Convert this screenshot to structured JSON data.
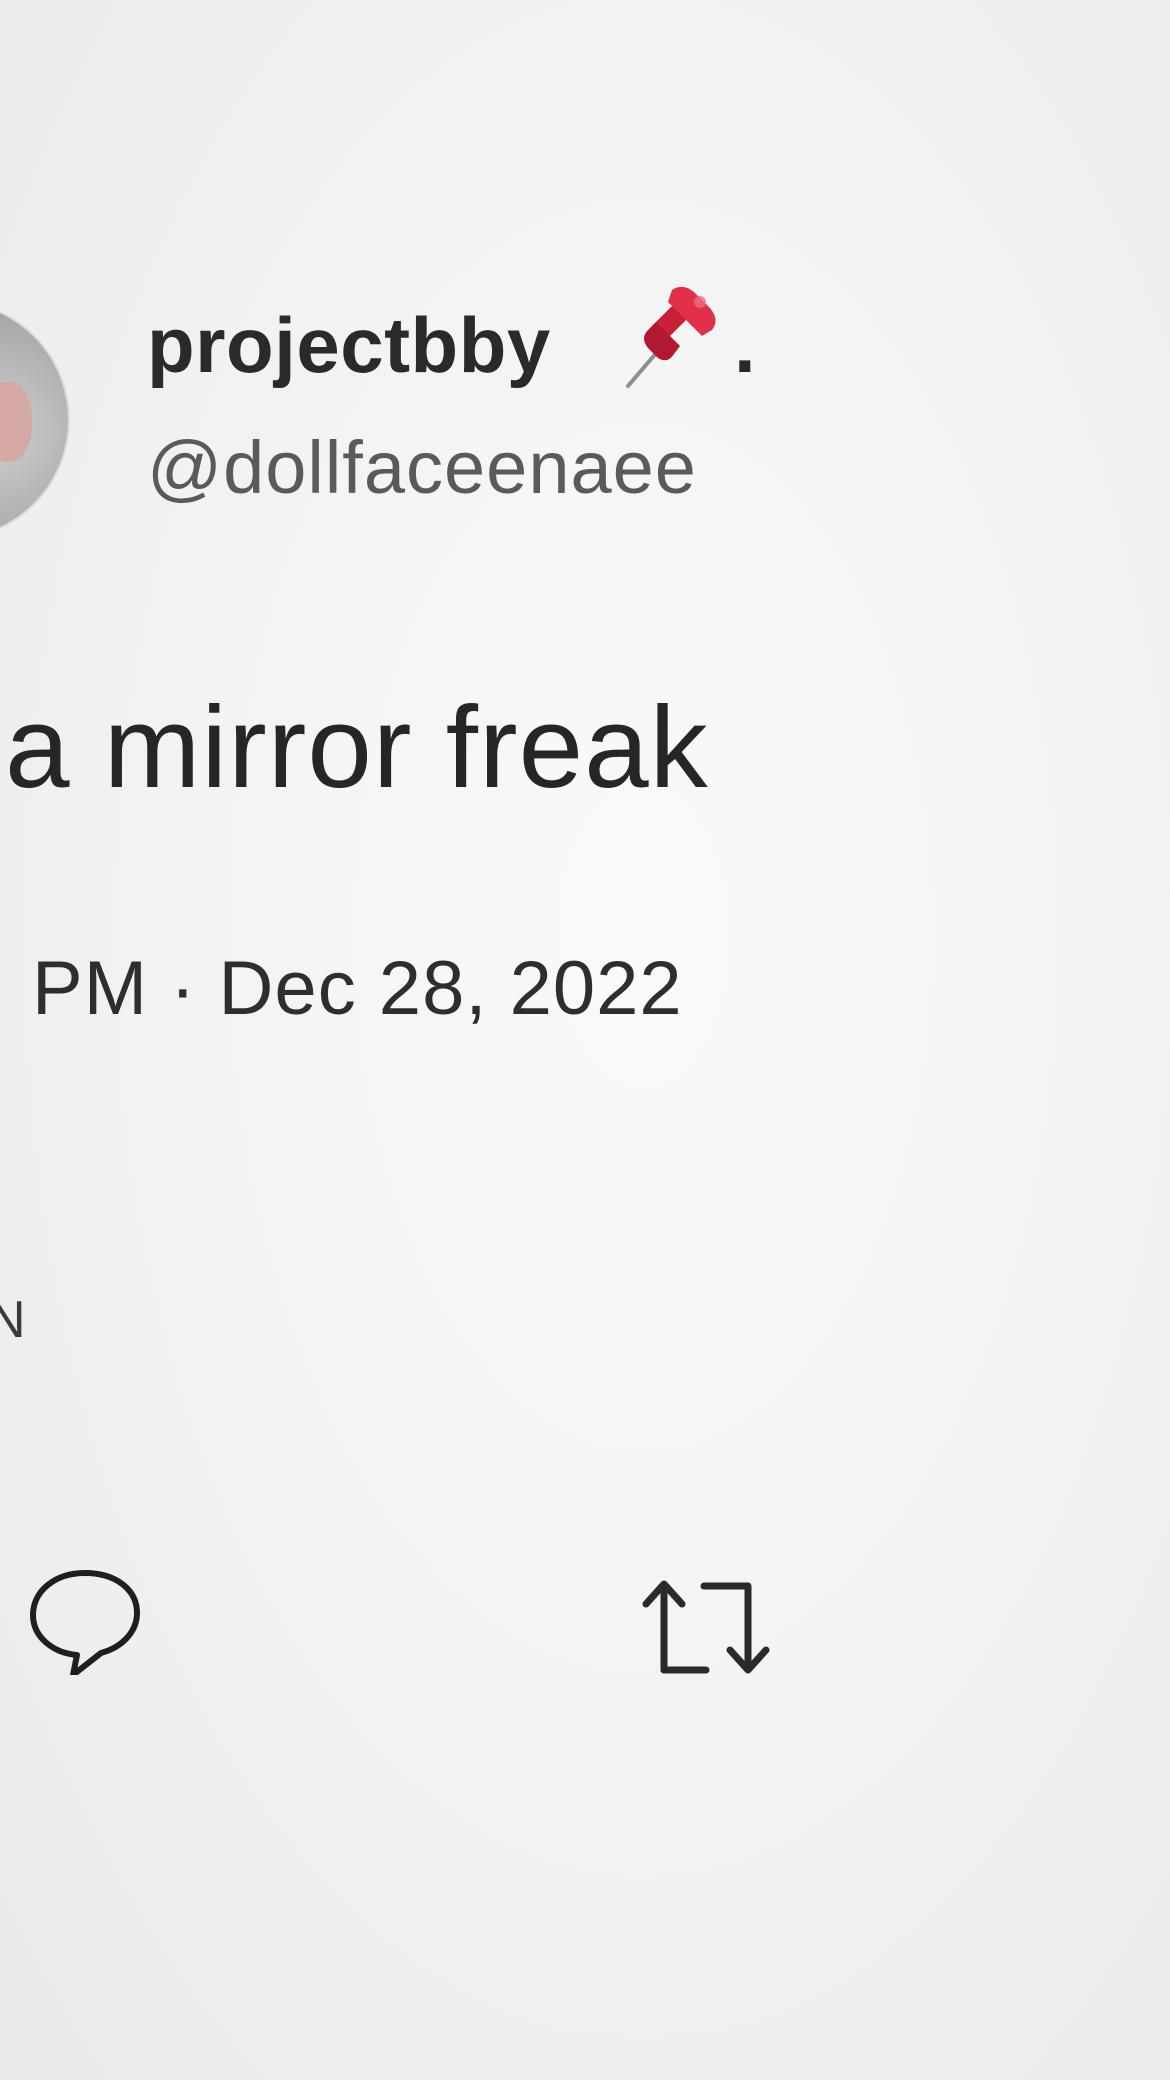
{
  "tweet": {
    "display_name": "projectbby",
    "name_suffix": ".",
    "name_emoji": "pushpin-icon",
    "handle": "@dollfaceenaee",
    "text": "a mirror freak",
    "meta": "PM · Dec 28, 2022",
    "cut_off_label": "N"
  },
  "actions": {
    "reply_icon": "reply-icon",
    "retweet_icon": "retweet-icon"
  },
  "colors": {
    "background": "#f4f4f4",
    "pin": "#d0233f",
    "text": "#262626",
    "secondary_text": "#5a5a5a"
  }
}
